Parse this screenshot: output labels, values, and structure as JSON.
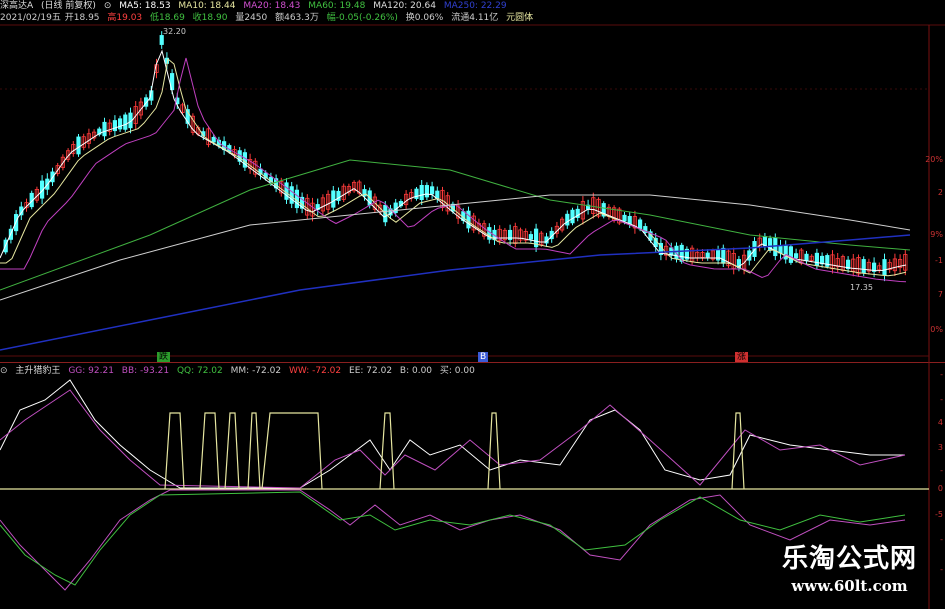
{
  "header": {
    "stock_name": "深高达A",
    "period": "(日线 前复权)",
    "ma5": "MA5: 18.53",
    "ma10": "MA10: 18.44",
    "ma20": "MA20: 18.43",
    "ma60": "MA60: 19.48",
    "ma120": "MA120: 20.64",
    "ma250": "MA250: 22.29"
  },
  "quote": {
    "date": "2021/02/19五",
    "open": "开18.95",
    "high": "高19.03",
    "low": "低18.69",
    "close": "收18.90",
    "volume": "量2450",
    "amount": "额463.3万",
    "change": "幅-0.05(-0.26%)",
    "turnover": "换0.06%",
    "float": "流通4.11亿",
    "unit": "元圆体"
  },
  "price_labels": {
    "high_marker": "32.20",
    "low_marker": "17.35"
  },
  "axis_ticks": [
    "20%",
    "2",
    "9%",
    "-1",
    "7",
    "0%"
  ],
  "indicator_axis_ticks": [
    "-",
    "-",
    "4",
    "3",
    "-",
    "0",
    "-5",
    "-",
    "-"
  ],
  "markers": [
    {
      "label": "跌",
      "color": "#2c9c2c"
    },
    {
      "label": "B",
      "color": "#3b5bd6"
    },
    {
      "label": "涨",
      "color": "#d03030"
    }
  ],
  "indicator": {
    "name": "主升猎豹王",
    "gg": "GG: 92.21",
    "bb": "BB: -93.21",
    "qq": "QQ: 72.02",
    "mm": "MM: -72.02",
    "ww": "WW: -72.02",
    "ee": "EE: 72.02",
    "b": "B: 0.00",
    "buy": "买: 0.00"
  },
  "colors": {
    "background": "#000000",
    "up_candle": "#ff3b3b",
    "down_candle": "#54ffff",
    "ma5": "#ffffff",
    "ma10": "#e6e6a0",
    "ma20": "#c040c0",
    "ma60": "#40b040",
    "ma120": "#d0d0d0",
    "ma250": "#2030c0",
    "grid": "#7a1010"
  },
  "watermark": {
    "title": "乐淘公式网",
    "url": "www.60lt.com"
  }
}
